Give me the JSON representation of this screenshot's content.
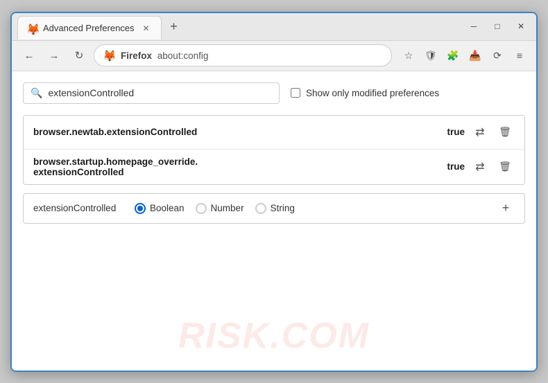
{
  "window": {
    "title": "Advanced Preferences",
    "favicon": "🦊"
  },
  "titlebar": {
    "tab_title": "Advanced Preferences",
    "new_tab_label": "+",
    "minimize_label": "─",
    "maximize_label": "□",
    "close_label": "✕"
  },
  "navbar": {
    "back_label": "←",
    "forward_label": "→",
    "refresh_label": "↻",
    "brand": "Firefox",
    "url": "about:config",
    "bookmark_label": "☆",
    "shield_label": "🛡",
    "extension_label": "🧩",
    "pocket_label": "📥",
    "sync_label": "⟳",
    "menu_label": "≡"
  },
  "search": {
    "value": "extensionControlled",
    "placeholder": "extensionControlled",
    "show_modified_label": "Show only modified preferences"
  },
  "preferences": [
    {
      "name": "browser.newtab.extensionControlled",
      "value": "true"
    },
    {
      "name_line1": "browser.startup.homepage_override.",
      "name_line2": "extensionControlled",
      "value": "true"
    }
  ],
  "new_pref": {
    "name": "extensionControlled",
    "types": [
      {
        "label": "Boolean",
        "selected": true
      },
      {
        "label": "Number",
        "selected": false
      },
      {
        "label": "String",
        "selected": false
      }
    ],
    "add_label": "+"
  },
  "watermark": "RISK.COM"
}
